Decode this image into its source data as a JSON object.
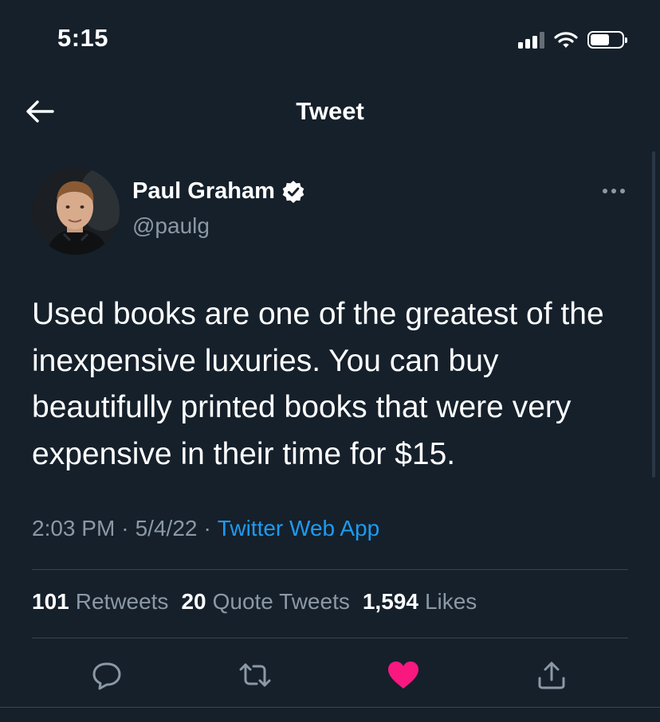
{
  "status_bar": {
    "time": "5:15"
  },
  "header": {
    "title": "Tweet",
    "back_icon": "arrow-left-icon"
  },
  "author": {
    "name": "Paul Graham",
    "handle": "@paulg",
    "verified": true
  },
  "tweet": {
    "text": "Used books are one of the greatest of the inexpensive luxuries. You can buy beautifully printed books that were very expensive in their time for $15.",
    "time": "2:03 PM",
    "date": "5/4/22",
    "separator": "·",
    "source": "Twitter Web App"
  },
  "stats": [
    {
      "count": "101",
      "label": "Retweets"
    },
    {
      "count": "20",
      "label": "Quote Tweets"
    },
    {
      "count": "1,594",
      "label": "Likes"
    }
  ],
  "actions": [
    {
      "icon": "reply-icon"
    },
    {
      "icon": "retweet-icon"
    },
    {
      "icon": "like-icon",
      "active": true
    },
    {
      "icon": "share-icon"
    }
  ],
  "colors": {
    "background": "#15202b",
    "secondary_text": "#8b98a5",
    "link": "#1d9bf0",
    "like_active": "#f91880",
    "divider": "#38444d"
  }
}
